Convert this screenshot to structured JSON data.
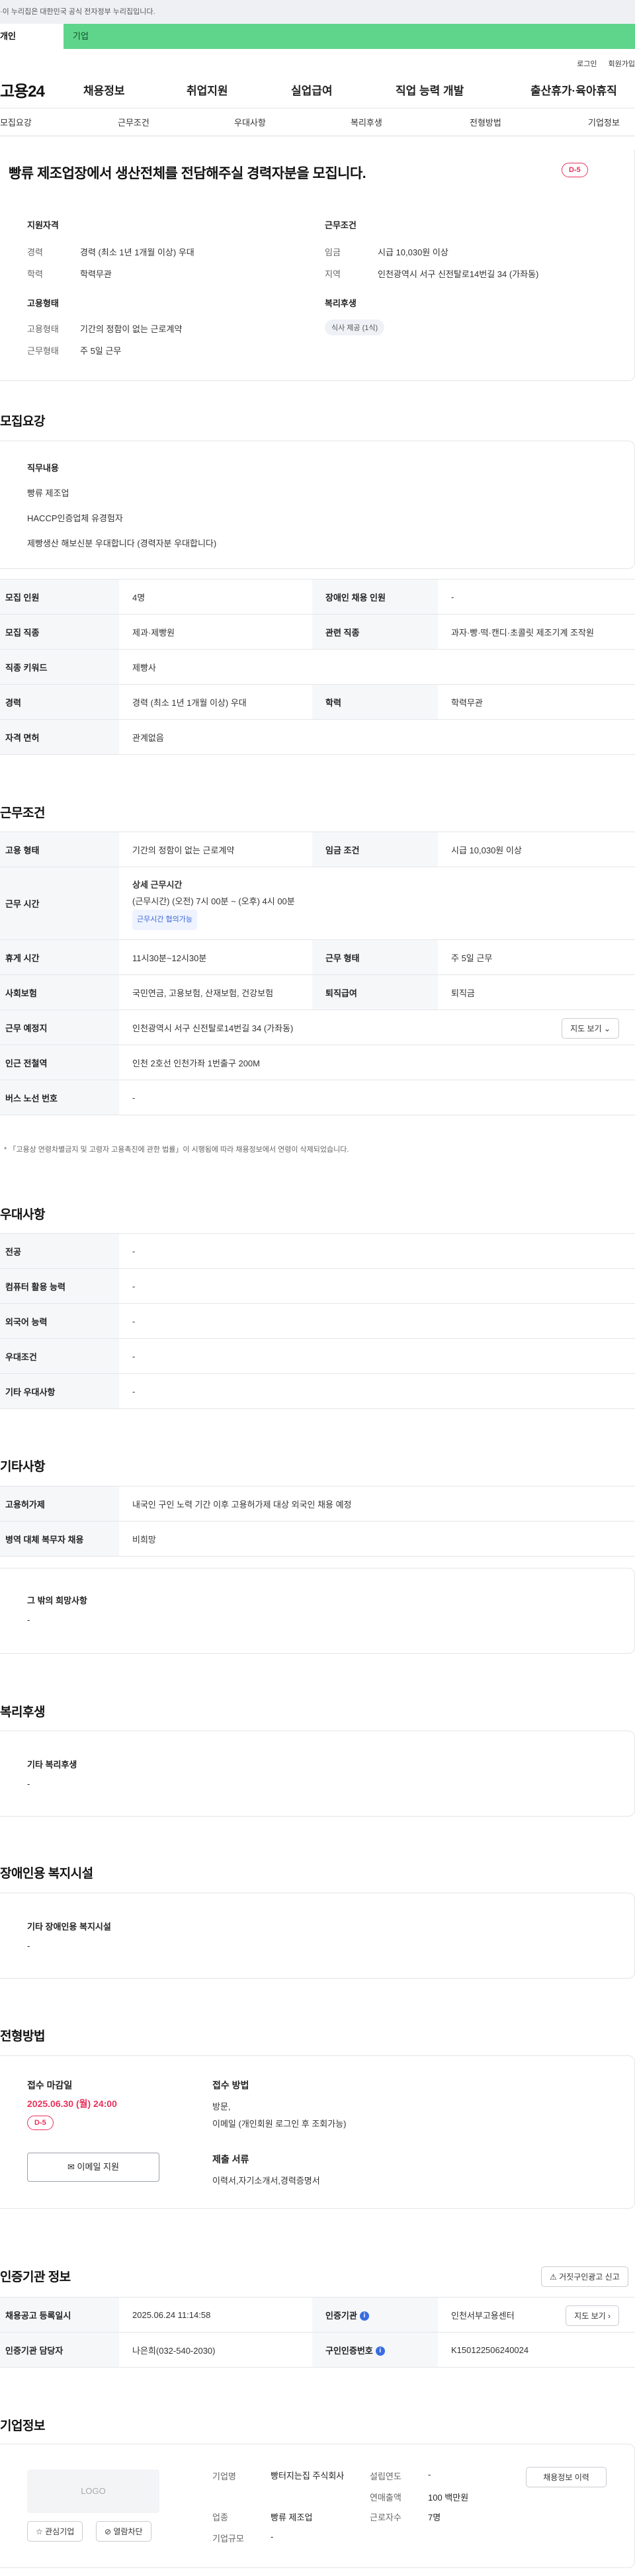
{
  "gov_banner": "·이 누리집은 대한민국 공식 전자정부 누리집입니다.",
  "mode_tabs": {
    "personal": "개인",
    "company": "기업"
  },
  "util": {
    "login": "로그인",
    "join": "회원가입"
  },
  "gnb": {
    "logo": "고용24",
    "items": [
      "채용정보",
      "취업지원",
      "실업급여",
      "직업 능력 개발",
      "출산휴가·육아휴직"
    ]
  },
  "subnav": [
    "모집요강",
    "근무조건",
    "우대사항",
    "복리후생",
    "전형방법",
    "기업정보"
  ],
  "header": {
    "title": "빵류 제조업장에서 생산전체를 전담해주실 경력자분을 모집니다.",
    "dday": "D-5",
    "qualification": {
      "label": "지원자격",
      "rows": [
        {
          "k": "경력",
          "v": "경력 (최소 1년 1개월 이상) 우대"
        },
        {
          "k": "학력",
          "v": "학력무관"
        }
      ]
    },
    "employment": {
      "label": "고용형태",
      "rows": [
        {
          "k": "고용형태",
          "v": "기간의 정함이 없는 근로계약"
        },
        {
          "k": "근무형태",
          "v": "주 5일 근무"
        }
      ]
    },
    "conditions": {
      "label": "근무조건",
      "rows": [
        {
          "k": "임금",
          "v": "시급 10,030원 이상"
        },
        {
          "k": "지역",
          "v": "인천광역시 서구 신전탈로14번길 34 (가좌동)"
        }
      ]
    },
    "welfare": {
      "label": "복리후생",
      "chip": "식사 제공 (1식)"
    }
  },
  "recruit": {
    "title": "모집요강",
    "duty_label": "직무내용",
    "duty_lines": [
      "빵류 제조업",
      "HACCP인증업체 유경험자",
      "제빵생산 해보신분 우대합니다 (경력자분 우대합니다)"
    ],
    "rows": [
      {
        "th1": "모집 인원",
        "td1": "4명",
        "th2": "장애인 채용 인원",
        "td2": "-"
      },
      {
        "th1": "모집 직종",
        "td1": "제과·제빵원",
        "th2": "관련 직종",
        "td2": "과자·빵·떡·캔디·초콜릿 제조기계 조작원"
      },
      {
        "th1": "직종 키워드",
        "td1": "제빵사"
      },
      {
        "th1": "경력",
        "td1": "경력 (최소 1년 1개월 이상) 우대",
        "th2": "학력",
        "td2": "학력무관"
      },
      {
        "th1": "자격 면허",
        "td1": "관계없음"
      }
    ]
  },
  "work": {
    "title": "근무조건",
    "type_th": "고용 형태",
    "type_td": "기간의 정함이 없는 근로계약",
    "wage_th": "임금 조건",
    "wage_td": "시급 10,030원 이상",
    "time_th": "근무 시간",
    "time_detail_label": "상세 근무시간",
    "time_detail": "(근무시간) (오전) 7시 00분 ~ (오후) 4시 00분",
    "time_tag": "근무시간 협의가능",
    "break_th": "휴게 시간",
    "break_td": "11시30분~12시30분",
    "form_th": "근무 형태",
    "form_td": "주 5일 근무",
    "insurance_th": "사회보험",
    "insurance_td": "국민연금, 고용보험, 산재보험, 건강보험",
    "retire_th": "퇴직급여",
    "retire_td": "퇴직금",
    "place_th": "근무 예정지",
    "place_td": "인천광역시 서구 신전탈로14번길 34 (가좌동)",
    "map_btn": "지도 보기",
    "subway_th": "인근 전철역",
    "subway_td": "인천 2호선 인천가좌 1번출구 200M",
    "bus_th": "버스 노선 번호",
    "bus_td": "-",
    "footnote": "「고용상 연령차별금지 및 고령자 고용촉진에 관한 법률」이 시행됨에 따라 채용정보에서 연령이 삭제되었습니다."
  },
  "prefer": {
    "title": "우대사항",
    "rows": [
      {
        "th": "전공",
        "td": "-"
      },
      {
        "th": "컴퓨터 활용 능력",
        "td": "-"
      },
      {
        "th": "외국어 능력",
        "td": "-"
      },
      {
        "th": "우대조건",
        "td": "-"
      },
      {
        "th": "기타 우대사항",
        "td": "-"
      }
    ]
  },
  "etc": {
    "title": "기타사항",
    "rows": [
      {
        "th": "고용허가제",
        "td": "내국인 구인 노력 기간 이후 고용허가제 대상 외국인 채용 예정"
      },
      {
        "th": "병역 대체 복무자 채용",
        "td": "비희망"
      }
    ],
    "box_label": "그 밖의 희망사항",
    "box_value": "-"
  },
  "benefit": {
    "title": "복리후생",
    "box_label": "기타 복리후생",
    "box_value": "-"
  },
  "disabled": {
    "title": "장애인용 복지시설",
    "box_label": "기타 장애인용 복지시설",
    "box_value": "-"
  },
  "selection": {
    "title": "전형방법",
    "deadline_label": "접수 마감일",
    "deadline": "2025.06.30 (월) 24:00",
    "dday": "D-5",
    "email_btn": "이메일 지원",
    "method_label": "접수 방법",
    "method_lines": [
      "방문,",
      "이메일 (개인회원 로그인 후 조회가능)"
    ],
    "docs_label": "제출 서류",
    "docs": "이력서,자기소개서,경력증명서"
  },
  "cert": {
    "title": "인증기관 정보",
    "report_btn": "거짓구인광고 신고",
    "reg_th": "채용공고 등록일시",
    "reg_td": "2025.06.24 11:14:58",
    "org_th": "인증기관",
    "org_td": "인천서부고용센터",
    "map_btn": "지도 보기",
    "manager_th": "인증기관 담당자",
    "manager_td": "나은희(032-540-2030)",
    "cert_no_th": "구인인증번호",
    "cert_no_td": "K150122506240024"
  },
  "company": {
    "title": "기업정보",
    "logo_placeholder": "LOGO",
    "fav_btn": "관심기업",
    "block_btn": "열람차단",
    "name_k": "기업명",
    "name_v": "빵터지는집 주식회사",
    "industry_k": "업종",
    "industry_v": "빵류 제조업",
    "size_k": "기업규모",
    "size_v": "-",
    "founded_k": "설립연도",
    "founded_v": "-",
    "revenue_k": "연매출액",
    "revenue_v": "100 백만원",
    "employees_k": "근로자수",
    "employees_v": "7명",
    "history_btn": "채용정보 이력"
  }
}
